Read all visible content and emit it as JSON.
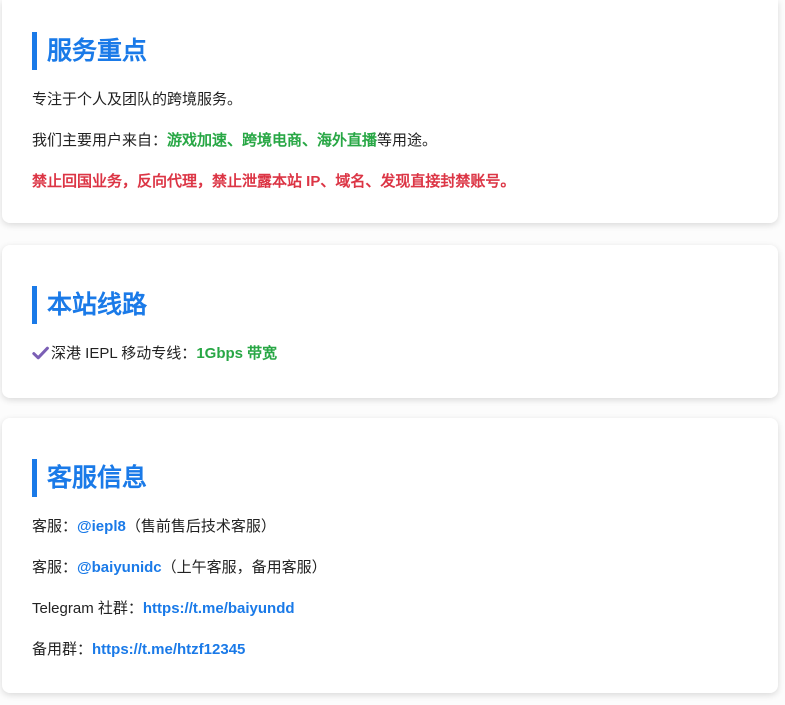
{
  "theme": {
    "accent": "#1a7ae8",
    "green": "#28a745",
    "red": "#dc3545",
    "text": "#222222",
    "check": "#7b5fb5"
  },
  "service_focus": {
    "title": "服务重点",
    "intro": "专注于个人及团队的跨境服务。",
    "users_prefix": "我们主要用户来自：",
    "users_highlight": "游戏加速、跨境电商、海外直播",
    "users_suffix": "等用途。",
    "warning": "禁止回国业务，反向代理，禁止泄露本站 IP、域名、发现直接封禁账号。"
  },
  "lines": {
    "title": "本站线路",
    "items": [
      {
        "icon": "check-icon",
        "label": "深港 IEPL 移动专线：",
        "highlight": "1Gbps 带宽"
      }
    ]
  },
  "support": {
    "title": "客服信息",
    "items": [
      {
        "label": "客服：",
        "link": "@iepl8",
        "note": "（售前售后技术客服）"
      },
      {
        "label": "客服：",
        "link": "@baiyunidc",
        "note": "（上午客服，备用客服）"
      },
      {
        "label": "Telegram 社群：",
        "link": "https://t.me/baiyundd"
      },
      {
        "label": "备用群：",
        "link": "https://t.me/htzf12345"
      }
    ]
  }
}
